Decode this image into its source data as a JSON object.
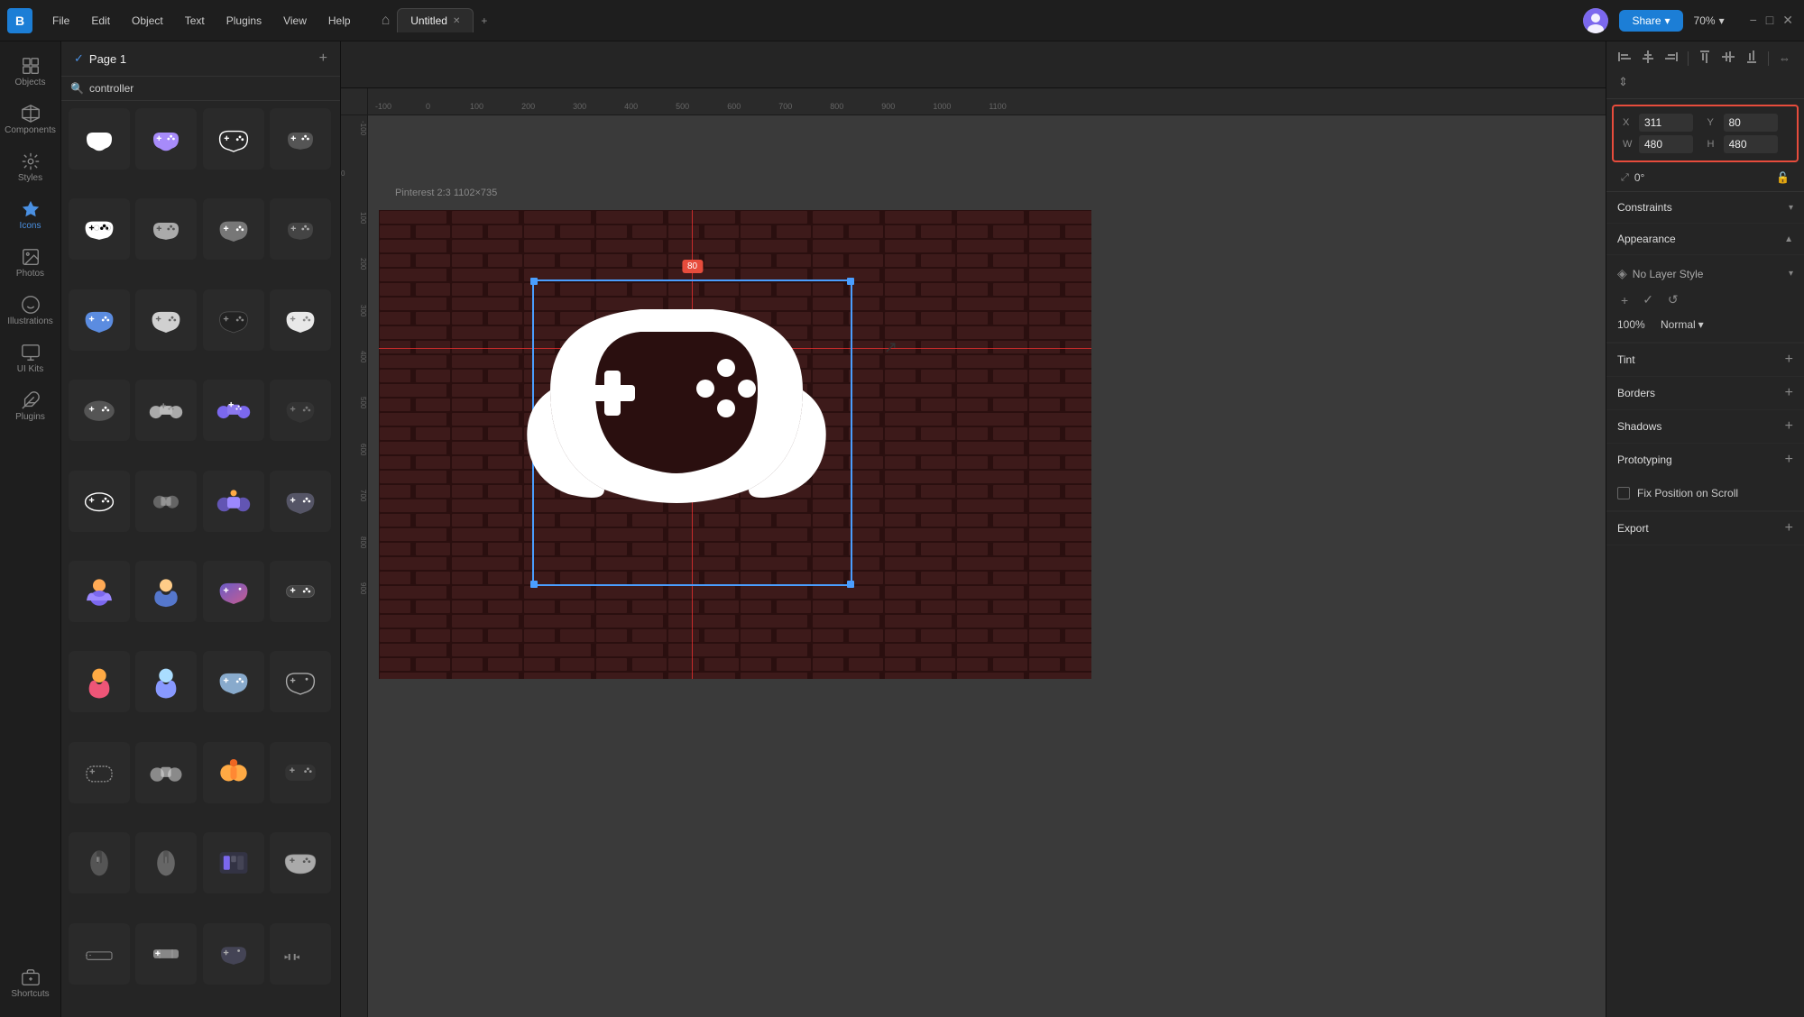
{
  "app": {
    "logo": "B",
    "tab_title": "Untitled",
    "menus": [
      "File",
      "Edit",
      "Object",
      "Text",
      "Plugins",
      "View",
      "Help"
    ],
    "home_icon": "⌂",
    "zoom": "70%",
    "share_label": "Share",
    "window_controls": [
      "−",
      "□",
      "×"
    ]
  },
  "left_sidebar": {
    "items": [
      {
        "id": "objects",
        "label": "Objects",
        "icon": "grid"
      },
      {
        "id": "components",
        "label": "Components",
        "icon": "components"
      },
      {
        "id": "styles",
        "label": "Styles",
        "icon": "styles"
      },
      {
        "id": "icons",
        "label": "Icons",
        "icon": "icons",
        "active": true
      },
      {
        "id": "photos",
        "label": "Photos",
        "icon": "photos"
      },
      {
        "id": "illustrations",
        "label": "Illustrations",
        "icon": "illustrations"
      },
      {
        "id": "uikits",
        "label": "UI Kits",
        "icon": "uikits"
      },
      {
        "id": "plugins",
        "label": "Plugins",
        "icon": "plugins"
      }
    ],
    "shortcuts": "Shortcuts"
  },
  "layers_panel": {
    "page_name": "Page 1",
    "search_placeholder": "controller",
    "add_page_label": "+"
  },
  "canvas": {
    "artboard_label": "Pinterest 2:3  1102×735",
    "guide_y": "80"
  },
  "right_panel": {
    "align_buttons": [
      "⊢",
      "⊥",
      "⊣",
      "⊤",
      "⊦",
      "⊤",
      "↔",
      "⋮",
      "↕"
    ],
    "position": {
      "x_label": "X",
      "x_value": "311",
      "y_label": "Y",
      "y_value": "80",
      "w_label": "W",
      "w_value": "480",
      "h_label": "H",
      "h_value": "480"
    },
    "angle": "0°",
    "sections": {
      "constraints": "Constraints",
      "appearance": "Appearance",
      "no_layer_style": "No Layer Style",
      "opacity": "100%",
      "blend_mode": "Normal",
      "tint": "Tint",
      "borders": "Borders",
      "shadows": "Shadows",
      "prototyping": "Prototyping",
      "fix_position_on_scroll": "Fix Position on Scroll",
      "export": "Export"
    }
  }
}
